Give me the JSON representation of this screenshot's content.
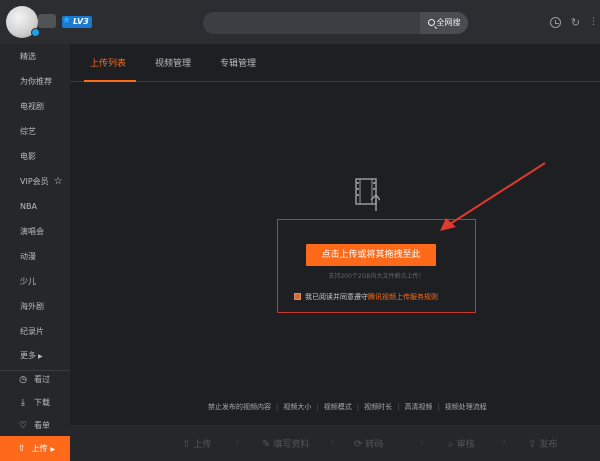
{
  "topbar": {
    "vip_level": "LV3",
    "search": {
      "placeholder": "",
      "value": "",
      "button_label": "全网搜"
    }
  },
  "sidebar": {
    "items": [
      {
        "label": "精选"
      },
      {
        "label": "为你推荐"
      },
      {
        "label": "电视剧"
      },
      {
        "label": "综艺"
      },
      {
        "label": "电影"
      },
      {
        "label": "VIP会员"
      },
      {
        "label": "NBA"
      },
      {
        "label": "演唱会"
      },
      {
        "label": "动漫"
      },
      {
        "label": "少儿"
      },
      {
        "label": "海外剧"
      },
      {
        "label": "纪录片"
      },
      {
        "label": "更多"
      }
    ],
    "tools": [
      {
        "label": "看过"
      },
      {
        "label": "下载"
      },
      {
        "label": "看单"
      }
    ],
    "upload": {
      "label": "上传"
    }
  },
  "main": {
    "tabs": [
      {
        "label": "上传列表",
        "active": true
      },
      {
        "label": "视频管理",
        "active": false
      },
      {
        "label": "专辑管理",
        "active": false
      }
    ],
    "upload": {
      "button_label": "点击上传或将其拖拽至此",
      "hint": "支持200个2GB内大文件断点上传！",
      "agree_text": "我已阅读并同意遵守",
      "agree_link": "腾讯视频上传服务规则",
      "agree_checked": true
    },
    "footer_links": [
      "禁止发布的视频内容",
      "视频大小",
      "视频模式",
      "视频时长",
      "高清视频",
      "视频处理流程"
    ],
    "steps": [
      "上传",
      "填写资料",
      "转码",
      "审核",
      "发布"
    ]
  },
  "colors": {
    "accent": "#ff6a1a",
    "highlight_box": "#c8352f",
    "background": "#1e1f22",
    "sidebar": "#26272b"
  }
}
